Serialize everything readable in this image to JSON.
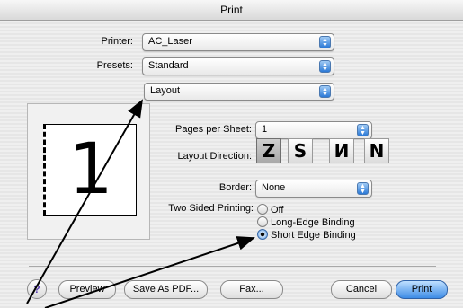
{
  "window": {
    "title": "Print"
  },
  "printer": {
    "label": "Printer:",
    "value": "AC_Laser"
  },
  "presets": {
    "label": "Presets:",
    "value": "Standard"
  },
  "pane": {
    "value": "Layout"
  },
  "pages_per_sheet": {
    "label": "Pages per Sheet:",
    "value": "1"
  },
  "layout_direction": {
    "label": "Layout Direction:",
    "options": [
      "Z",
      "S",
      "N",
      "N"
    ],
    "selected_index": 0
  },
  "border": {
    "label": "Border:",
    "value": "None"
  },
  "two_sided": {
    "label": "Two Sided Printing:",
    "options": [
      "Off",
      "Long-Edge Binding",
      "Short Edge Binding"
    ],
    "selected_index": 2
  },
  "preview_sheet": {
    "number": "1"
  },
  "buttons": {
    "help": "?",
    "preview": "Preview",
    "save_as_pdf": "Save As PDF...",
    "fax": "Fax...",
    "cancel": "Cancel",
    "print": "Print"
  },
  "colors": {
    "accent": "#3d8ce6",
    "arrow": "#000000"
  }
}
